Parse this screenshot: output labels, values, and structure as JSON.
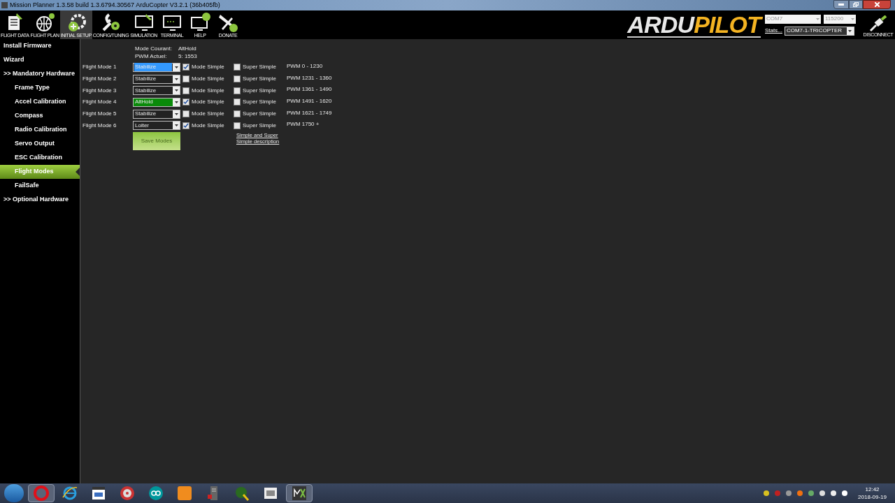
{
  "window": {
    "title": "Mission Planner 1.3.58 build 1.3.6794.30567 ArduCopter V3.2.1 (36b405fb)"
  },
  "toolbar": [
    {
      "label": "FLIGHT DATA",
      "kind": "flightdata",
      "selected": false
    },
    {
      "label": "FLIGHT PLAN",
      "kind": "flightplan",
      "selected": false
    },
    {
      "label": "INITIAL SETUP",
      "kind": "setup",
      "selected": true
    },
    {
      "label": "CONFIG/TUNING",
      "kind": "config",
      "selected": false
    },
    {
      "label": "SIMULATION",
      "kind": "simulation",
      "selected": false
    },
    {
      "label": "TERMINAL",
      "kind": "terminal",
      "selected": false
    },
    {
      "label": "HELP",
      "kind": "help",
      "selected": false
    },
    {
      "label": "DONATE",
      "kind": "donate",
      "selected": false
    }
  ],
  "logo": {
    "part_1": "ARDU",
    "part_2": "PILOT"
  },
  "connection": {
    "port": "COM7",
    "baud": "115200",
    "stats_link": "Stats...",
    "vehicle": "COM7-1-TRICOPTER",
    "disconnect": "DISCONNECT"
  },
  "sidebar": {
    "items": [
      {
        "label": "Install Firmware",
        "selected": false
      },
      {
        "label": "Wizard",
        "selected": false
      },
      {
        "label": ">> Mandatory Hardware",
        "selected": false,
        "children": [
          {
            "label": "Frame Type",
            "selected": false
          },
          {
            "label": "Accel Calibration",
            "selected": false
          },
          {
            "label": "Compass",
            "selected": false
          },
          {
            "label": "Radio Calibration",
            "selected": false
          },
          {
            "label": "Servo Output",
            "selected": false
          },
          {
            "label": "ESC Calibration",
            "selected": false
          },
          {
            "label": "Flight Modes",
            "selected": true
          },
          {
            "label": "FailSafe",
            "selected": false
          }
        ]
      },
      {
        "label": ">> Optional Hardware",
        "selected": false
      }
    ]
  },
  "status": {
    "mode_label": "Mode Courant:",
    "mode_value": "AltHold",
    "pwm_label": "PWM Actuel:",
    "pwm_value": "5: 1553"
  },
  "flight_modes": [
    {
      "label": "Flight Mode 1",
      "mode": "Stabilize",
      "focused": true,
      "current": false,
      "simple_label": "Mode Simple",
      "simple_checked": true,
      "super_label": "Super Simple",
      "super_checked": false,
      "pwm": "PWM 0 - 1230"
    },
    {
      "label": "Flight Mode 2",
      "mode": "Stabilize",
      "focused": false,
      "current": false,
      "simple_label": "Mode Simple",
      "simple_checked": false,
      "super_label": "Super Simple",
      "super_checked": false,
      "pwm": "PWM 1231 - 1360"
    },
    {
      "label": "Flight Mode 3",
      "mode": "Stabilize",
      "focused": false,
      "current": false,
      "simple_label": "Mode Simple",
      "simple_checked": false,
      "super_label": "Super Simple",
      "super_checked": false,
      "pwm": "PWM 1361 - 1490"
    },
    {
      "label": "Flight Mode 4",
      "mode": "AltHold",
      "focused": false,
      "current": true,
      "simple_label": "Mode Simple",
      "simple_checked": true,
      "super_label": "Super Simple",
      "super_checked": false,
      "pwm": "PWM 1491 - 1620"
    },
    {
      "label": "Flight Mode 5",
      "mode": "Stabilize",
      "focused": false,
      "current": false,
      "simple_label": "Mode Simple",
      "simple_checked": false,
      "super_label": "Super Simple",
      "super_checked": false,
      "pwm": "PWM 1621 - 1749"
    },
    {
      "label": "Flight Mode 6",
      "mode": "Loiter",
      "focused": false,
      "current": false,
      "simple_label": "Mode Simple",
      "simple_checked": true,
      "super_label": "Super Simple",
      "super_checked": false,
      "pwm": "PWM 1750 +"
    }
  ],
  "save_button": "Save Modes",
  "description_link": "Simple and Super Simple description",
  "taskbar": {
    "apps": [
      {
        "kind": "browser-o",
        "selected": true
      },
      {
        "kind": "ie",
        "selected": false
      },
      {
        "kind": "clapper",
        "selected": false
      },
      {
        "kind": "disc",
        "selected": false
      },
      {
        "kind": "infinity",
        "selected": false
      },
      {
        "kind": "square",
        "selected": false
      },
      {
        "kind": "server",
        "selected": false
      },
      {
        "kind": "globe",
        "selected": false
      },
      {
        "kind": "film",
        "selected": false
      },
      {
        "kind": "mp",
        "selected": true
      }
    ],
    "time": "12:42",
    "date": "2018-09-19"
  }
}
